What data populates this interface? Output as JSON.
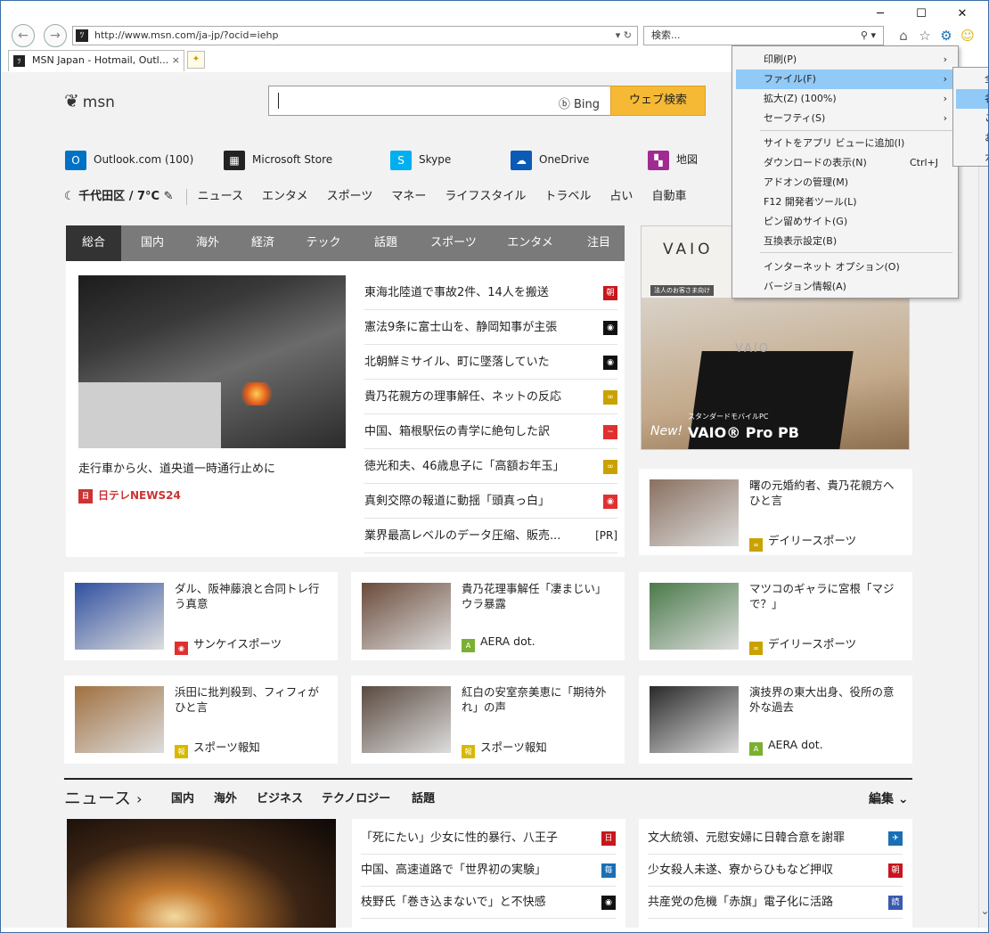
{
  "browser": {
    "url": "http://www.msn.com/ja-jp/?ocid=iehp",
    "search_placeholder": "検索...",
    "tab_title": "MSN Japan - Hotmail, Outl...",
    "tab_close": "×",
    "nav_back": "←",
    "nav_forward": "→",
    "addr_controls": "▾ ↻",
    "search_controls": "⚲ ▾",
    "tool_icons": {
      "home": "⌂",
      "favorites": "☆",
      "tools": "⚙",
      "smile": "☺"
    },
    "window_controls": {
      "minimize": "─",
      "maximize": "☐",
      "close": "✕"
    },
    "favicon": "ﾂ"
  },
  "msn": {
    "logo": "msn",
    "logo_glyph": "❦",
    "bing_label": "ⓑ Bing",
    "search_button": "ウェブ検索",
    "services": [
      {
        "label": "Outlook.com (100)",
        "icon": "O",
        "color": "#0072c6"
      },
      {
        "label": "Microsoft Store",
        "icon": "▦",
        "color": "#222222"
      },
      {
        "label": "Skype",
        "icon": "S",
        "color": "#00aff0"
      },
      {
        "label": "OneDrive",
        "icon": "☁",
        "color": "#0a5ab6"
      },
      {
        "label": "地図",
        "icon": "▚",
        "color": "#a02b93"
      }
    ],
    "weather": "☾ 千代田区 / 7°C ✎",
    "categories": [
      "ニュース",
      "エンタメ",
      "スポーツ",
      "マネー",
      "ライフスタイル",
      "トラベル",
      "占い",
      "自動車"
    ]
  },
  "news_tabs": [
    "総合",
    "国内",
    "海外",
    "経済",
    "テック",
    "話題",
    "スポーツ",
    "エンタメ",
    "注目"
  ],
  "hero": {
    "caption": "走行車から火、道央道一時通行止めに",
    "source": "日テレNEWS24",
    "source_icon": "日"
  },
  "headlines": [
    {
      "text": "東海北陸道で事故2件、14人を搬送",
      "icon": "朝",
      "color": "#c8161d"
    },
    {
      "text": "憲法9条に富士山を、静岡知事が主張",
      "icon": "◉",
      "color": "#111111"
    },
    {
      "text": "北朝鮮ミサイル、町に墜落していた",
      "icon": "◉",
      "color": "#111111"
    },
    {
      "text": "貴乃花親方の理事解任、ネットの反応",
      "icon": "∞",
      "color": "#c9a200"
    },
    {
      "text": "中国、箱根駅伝の青学に絶句した訳",
      "icon": "~",
      "color": "#e03030"
    },
    {
      "text": "徳光和夫、46歳息子に「高額お年玉」",
      "icon": "∞",
      "color": "#c9a200"
    },
    {
      "text": "真剣交際の報道に動揺「頭真っ白」",
      "icon": "◉",
      "color": "#e03030"
    },
    {
      "text": "業界最高レベルのデータ圧縮、販売...",
      "pr": "[PR]"
    }
  ],
  "ad": {
    "brand": "VAIO",
    "pc_logo": "VAIO",
    "tagline_small": "法人のお客さま向け",
    "standard": "スタンダードモバイルPC",
    "new": "New!",
    "product": "VAIO® Pro PB"
  },
  "cards": [
    {
      "title": "曙の元婚約者、貴乃花親方へひと言",
      "source": "デイリースポーツ",
      "icon": "∞",
      "color": "#c9a200",
      "thumb": "#8a7060"
    },
    {
      "title": "ダル、阪神藤浪と合同トレ行う真意",
      "source": "サンケイスポーツ",
      "icon": "◉",
      "color": "#e03030",
      "thumb": "#3050a0"
    },
    {
      "title": "貴乃花理事解任「凄まじい」ウラ暴露",
      "source": "AERA dot.",
      "icon": "A",
      "color": "#7ab030",
      "thumb": "#6a4a3a"
    },
    {
      "title": "マツコのギャラに宮根「マジで？」",
      "source": "デイリースポーツ",
      "icon": "∞",
      "color": "#c9a200",
      "thumb": "#4a7a4a"
    },
    {
      "title": "浜田に批判殺到、フィフィがひと言",
      "source": "スポーツ報知",
      "icon": "報",
      "color": "#d8b800",
      "thumb": "#a07040"
    },
    {
      "title": "紅白の安室奈美恵に「期待外れ」の声",
      "source": "スポーツ報知",
      "icon": "報",
      "color": "#d8b800",
      "thumb": "#5a4a40"
    },
    {
      "title": "演技界の東大出身、役所の意外な過去",
      "source": "AERA dot.",
      "icon": "A",
      "color": "#7ab030",
      "thumb": "#2a2a2a"
    }
  ],
  "news_section": {
    "title": "ニュース",
    "chev": "›",
    "subnav": [
      "国内",
      "海外",
      "ビジネス",
      "テクノロジー",
      "話題"
    ],
    "edit": "編集 ⌄",
    "col1": [
      {
        "text": "「死にたい」少女に性的暴行、八王子",
        "icon": "日",
        "color": "#c8161d"
      },
      {
        "text": "中国、高速道路で「世界初の実験」",
        "icon": "毎",
        "color": "#1a6fb5"
      },
      {
        "text": "枝野氏「巻き込まないで」と不快感",
        "icon": "◉",
        "color": "#111111"
      }
    ],
    "col2": [
      {
        "text": "文大統領、元慰安婦に日韓合意を謝罪",
        "icon": "✈",
        "color": "#1a6fb5"
      },
      {
        "text": "少女殺人未遂、寮からひもなど押収",
        "icon": "朝",
        "color": "#c8161d"
      },
      {
        "text": "共産党の危機「赤旗」電子化に活路",
        "icon": "読",
        "color": "#3a5ab0"
      }
    ]
  },
  "tools_menu": {
    "items": [
      {
        "label": "印刷(P)",
        "arrow": "›"
      },
      {
        "label": "ファイル(F)",
        "arrow": "›",
        "highlight": true
      },
      {
        "label": "拡大(Z) (100%)",
        "arrow": "›"
      },
      {
        "label": "セーフティ(S)",
        "arrow": "›"
      },
      {
        "label": "サイトをアプリ ビューに追加(I)"
      },
      {
        "label": "ダウンロードの表示(N)",
        "shortcut": "Ctrl+J"
      },
      {
        "label": "アドオンの管理(M)"
      },
      {
        "label": "F12 開発者ツール(L)"
      },
      {
        "label": "ピン留めサイト(G)"
      },
      {
        "label": "互換表示設定(B)"
      },
      {
        "label": "インターネット オプション(O)"
      },
      {
        "label": "バージョン情報(A)"
      }
    ],
    "submenu": [
      "全",
      "名",
      "こ",
      "お",
      "ガ"
    ]
  },
  "scroll_arrow": "⌄"
}
